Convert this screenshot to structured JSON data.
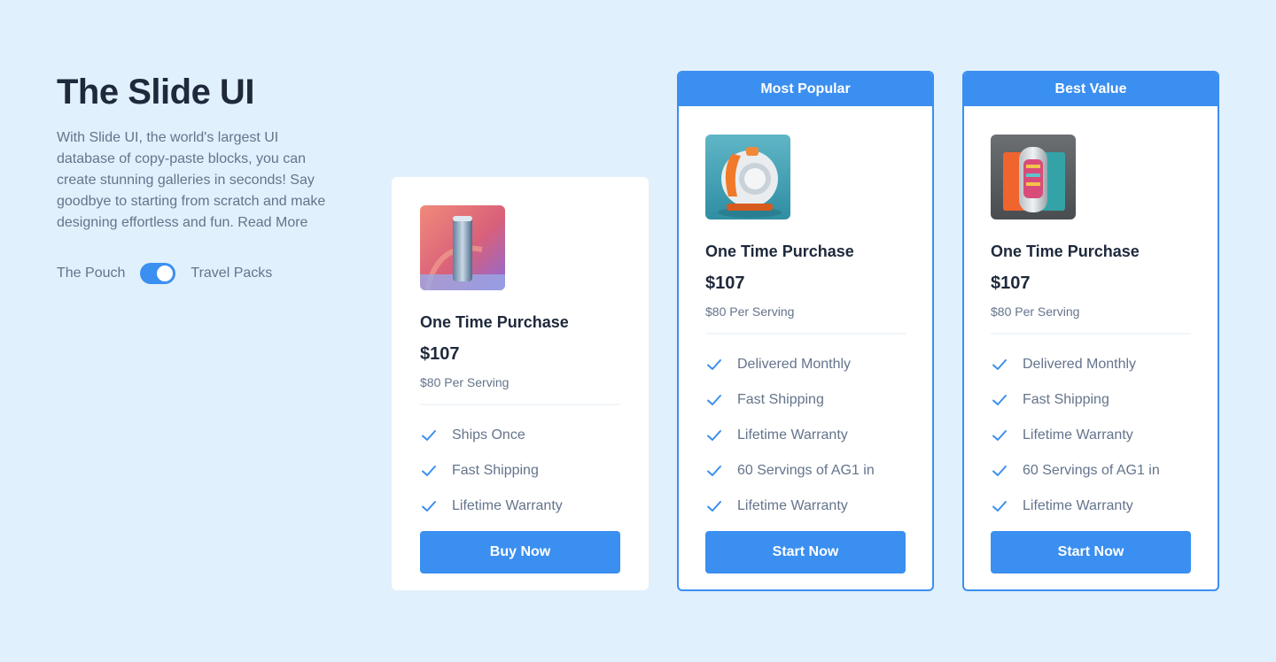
{
  "intro": {
    "title": "The Slide UI",
    "description": "With Slide UI, the world's largest UI database of copy-paste blocks, you can create stunning galleries in seconds! Say goodbye to starting from scratch and make designing effortless and fun.  Read More",
    "toggle_left": "The Pouch",
    "toggle_right": "Travel Packs",
    "toggle_on": true
  },
  "colors": {
    "accent": "#3b8ff0",
    "background": "#e1f0fd"
  },
  "cards": [
    {
      "banner": "",
      "image": "silver-bottle-on-pink",
      "title": "One Time Purchase",
      "price": "$107",
      "serving": "$80 Per Serving",
      "features": [
        "Ships Once",
        "Fast Shipping",
        "Lifetime Warranty"
      ],
      "button": "Buy Now"
    },
    {
      "banner": "Most Popular",
      "image": "orange-white-device-on-teal",
      "title": "One Time Purchase",
      "price": "$107",
      "serving": "$80 Per Serving",
      "features": [
        "Delivered Monthly",
        "Fast Shipping",
        "Lifetime Warranty",
        "60 Servings of AG1 in",
        "Lifetime Warranty"
      ],
      "button": "Start Now"
    },
    {
      "banner": "Best Value",
      "image": "orange-teal-device-on-gray",
      "title": "One Time Purchase",
      "price": "$107",
      "serving": "$80 Per Serving",
      "features": [
        "Delivered Monthly",
        "Fast Shipping",
        "Lifetime Warranty",
        "60 Servings of AG1 in",
        "Lifetime Warranty"
      ],
      "button": "Start Now"
    }
  ]
}
